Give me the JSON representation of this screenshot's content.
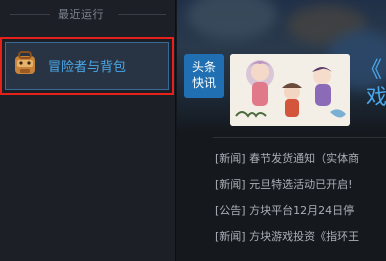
{
  "sidebar": {
    "section_title": "最近运行",
    "recent_items": [
      {
        "title": "冒险者与背包",
        "icon": "backpack-icon"
      }
    ]
  },
  "news_panel": {
    "badge_line1": "头条",
    "badge_line2": "快讯",
    "headline_title_line1": "《",
    "headline_title_line2": "戏",
    "items": [
      "[新闻] 春节发货通知（实体商",
      "[新闻] 元旦特选活动已开启!",
      "[公告] 方块平台12月24日停",
      "[新闻] 方块游戏投资《指环王"
    ]
  },
  "colors": {
    "accent_blue": "#4aa8ea",
    "highlight_red": "#e52119",
    "badge_blue": "#1f6fb2"
  }
}
